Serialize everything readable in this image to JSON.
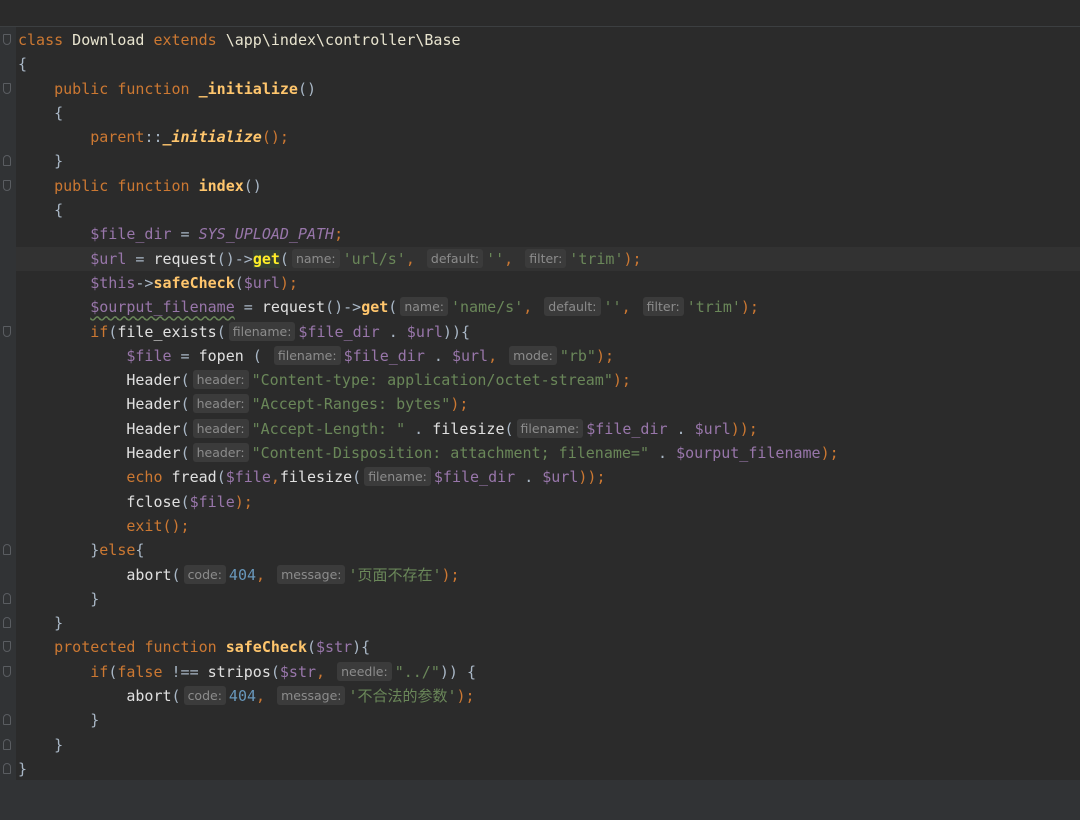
{
  "code": {
    "lines": [
      {
        "tokens": [
          {
            "t": "class",
            "c": "kw"
          },
          {
            "t": " Download ",
            "c": "cls"
          },
          {
            "t": "extends",
            "c": "kw"
          },
          {
            "t": " \\app\\index\\controller\\Base",
            "c": "cls"
          }
        ],
        "fold": "open"
      },
      {
        "tokens": [
          {
            "t": "{",
            "c": "plain"
          }
        ]
      },
      {
        "tokens": [
          {
            "t": "    "
          },
          {
            "t": "public",
            "c": "kw"
          },
          {
            "t": " "
          },
          {
            "t": "function",
            "c": "kw"
          },
          {
            "t": " "
          },
          {
            "t": "_initialize",
            "c": "fnb"
          },
          {
            "t": "()",
            "c": "plain"
          }
        ],
        "fold": "open"
      },
      {
        "tokens": [
          {
            "t": "    {",
            "c": "plain"
          }
        ]
      },
      {
        "tokens": [
          {
            "t": "        "
          },
          {
            "t": "parent",
            "c": "kw"
          },
          {
            "t": "::",
            "c": "plain"
          },
          {
            "t": "_initialize",
            "c": "fni"
          },
          {
            "t": "();",
            "c": "kw"
          }
        ]
      },
      {
        "tokens": [
          {
            "t": "    }",
            "c": "plain"
          }
        ],
        "fold": "close"
      },
      {
        "tokens": [
          {
            "t": "    "
          },
          {
            "t": "public",
            "c": "kw"
          },
          {
            "t": " "
          },
          {
            "t": "function",
            "c": "kw"
          },
          {
            "t": " "
          },
          {
            "t": "index",
            "c": "fnb"
          },
          {
            "t": "()",
            "c": "plain"
          }
        ],
        "fold": "open"
      },
      {
        "tokens": [
          {
            "t": "    {",
            "c": "plain"
          }
        ]
      },
      {
        "tokens": [
          {
            "t": "        "
          },
          {
            "t": "$file_dir",
            "c": "var"
          },
          {
            "t": " = ",
            "c": "plain"
          },
          {
            "t": "SYS_UPLOAD_PATH",
            "c": "const"
          },
          {
            "t": ";",
            "c": "kw"
          }
        ]
      },
      {
        "current": true,
        "tokens": [
          {
            "t": "        "
          },
          {
            "t": "$url",
            "c": "var"
          },
          {
            "t": " = ",
            "c": "plain"
          },
          {
            "t": "request",
            "c": "call"
          },
          {
            "t": "()->",
            "c": "plain"
          },
          {
            "t": "get",
            "c": "hl-get"
          },
          {
            "t": "(",
            "c": "plain"
          },
          {
            "h": "name:"
          },
          {
            "t": "'url/s'",
            "c": "str"
          },
          {
            "t": ", ",
            "c": "kw"
          },
          {
            "h": "default:"
          },
          {
            "t": "''",
            "c": "str"
          },
          {
            "t": ", ",
            "c": "kw"
          },
          {
            "h": "filter:"
          },
          {
            "t": "'trim'",
            "c": "str"
          },
          {
            "t": ");",
            "c": "kw"
          }
        ]
      },
      {
        "tokens": [
          {
            "t": "        "
          },
          {
            "t": "$this",
            "c": "var"
          },
          {
            "t": "->",
            "c": "plain"
          },
          {
            "t": "safeCheck",
            "c": "fnb"
          },
          {
            "t": "(",
            "c": "plain"
          },
          {
            "t": "$url",
            "c": "var"
          },
          {
            "t": ");",
            "c": "kw"
          }
        ]
      },
      {
        "tokens": [
          {
            "t": "        "
          },
          {
            "t": "$ourput_filename",
            "c": "var squiggle"
          },
          {
            "t": " = ",
            "c": "plain"
          },
          {
            "t": "request",
            "c": "call"
          },
          {
            "t": "()->",
            "c": "plain"
          },
          {
            "t": "get",
            "c": "fnb"
          },
          {
            "t": "(",
            "c": "plain"
          },
          {
            "h": "name:"
          },
          {
            "t": "'name/s'",
            "c": "str"
          },
          {
            "t": ", ",
            "c": "kw"
          },
          {
            "h": "default:"
          },
          {
            "t": "''",
            "c": "str"
          },
          {
            "t": ", ",
            "c": "kw"
          },
          {
            "h": "filter:"
          },
          {
            "t": "'trim'",
            "c": "str"
          },
          {
            "t": ");",
            "c": "kw"
          }
        ]
      },
      {
        "tokens": [
          {
            "t": "        "
          },
          {
            "t": "if",
            "c": "kw"
          },
          {
            "t": "(",
            "c": "plain"
          },
          {
            "t": "file_exists",
            "c": "call"
          },
          {
            "t": "(",
            "c": "plain"
          },
          {
            "h": "filename:"
          },
          {
            "t": "$file_dir",
            "c": "var"
          },
          {
            "t": " . ",
            "c": "plain"
          },
          {
            "t": "$url",
            "c": "var"
          },
          {
            "t": ")){",
            "c": "plain"
          }
        ],
        "fold": "open"
      },
      {
        "tokens": [
          {
            "t": "            "
          },
          {
            "t": "$file",
            "c": "var"
          },
          {
            "t": " = ",
            "c": "plain"
          },
          {
            "t": "fopen",
            "c": "call"
          },
          {
            "t": " ( ",
            "c": "plain"
          },
          {
            "h": "filename:"
          },
          {
            "t": "$file_dir",
            "c": "var"
          },
          {
            "t": " . ",
            "c": "plain"
          },
          {
            "t": "$url",
            "c": "var"
          },
          {
            "t": ", ",
            "c": "kw"
          },
          {
            "h": "mode:"
          },
          {
            "t": "\"rb\"",
            "c": "str"
          },
          {
            "t": ");",
            "c": "kw"
          }
        ]
      },
      {
        "tokens": [
          {
            "t": "            "
          },
          {
            "t": "Header",
            "c": "call"
          },
          {
            "t": "(",
            "c": "plain"
          },
          {
            "h": "header:"
          },
          {
            "t": "\"Content-type: application/octet-stream\"",
            "c": "str"
          },
          {
            "t": ");",
            "c": "kw"
          }
        ]
      },
      {
        "tokens": [
          {
            "t": "            "
          },
          {
            "t": "Header",
            "c": "call"
          },
          {
            "t": "(",
            "c": "plain"
          },
          {
            "h": "header:"
          },
          {
            "t": "\"Accept-Ranges: bytes\"",
            "c": "str"
          },
          {
            "t": ");",
            "c": "kw"
          }
        ]
      },
      {
        "tokens": [
          {
            "t": "            "
          },
          {
            "t": "Header",
            "c": "call"
          },
          {
            "t": "(",
            "c": "plain"
          },
          {
            "h": "header:"
          },
          {
            "t": "\"Accept-Length: \"",
            "c": "str"
          },
          {
            "t": " . ",
            "c": "plain"
          },
          {
            "t": "filesize",
            "c": "call"
          },
          {
            "t": "(",
            "c": "plain"
          },
          {
            "h": "filename:"
          },
          {
            "t": "$file_dir",
            "c": "var"
          },
          {
            "t": " . ",
            "c": "plain"
          },
          {
            "t": "$url",
            "c": "var"
          },
          {
            "t": "));",
            "c": "kw"
          }
        ]
      },
      {
        "tokens": [
          {
            "t": "            "
          },
          {
            "t": "Header",
            "c": "call"
          },
          {
            "t": "(",
            "c": "plain"
          },
          {
            "h": "header:"
          },
          {
            "t": "\"Content-Disposition: attachment; filename=\"",
            "c": "str"
          },
          {
            "t": " . ",
            "c": "plain"
          },
          {
            "t": "$ourput_filename",
            "c": "var"
          },
          {
            "t": ");",
            "c": "kw"
          }
        ]
      },
      {
        "tokens": [
          {
            "t": "            "
          },
          {
            "t": "echo",
            "c": "kw"
          },
          {
            "t": " "
          },
          {
            "t": "fread",
            "c": "call"
          },
          {
            "t": "(",
            "c": "plain"
          },
          {
            "t": "$file",
            "c": "var"
          },
          {
            "t": ",",
            "c": "kw"
          },
          {
            "t": "filesize",
            "c": "call"
          },
          {
            "t": "(",
            "c": "plain"
          },
          {
            "h": "filename:"
          },
          {
            "t": "$file_dir",
            "c": "var"
          },
          {
            "t": " . ",
            "c": "plain"
          },
          {
            "t": "$url",
            "c": "var"
          },
          {
            "t": "));",
            "c": "kw"
          }
        ]
      },
      {
        "tokens": [
          {
            "t": "            "
          },
          {
            "t": "fclose",
            "c": "call"
          },
          {
            "t": "(",
            "c": "plain"
          },
          {
            "t": "$file",
            "c": "var"
          },
          {
            "t": ");",
            "c": "kw"
          }
        ]
      },
      {
        "tokens": [
          {
            "t": "            "
          },
          {
            "t": "exit",
            "c": "kw"
          },
          {
            "t": "();",
            "c": "kw"
          }
        ]
      },
      {
        "tokens": [
          {
            "t": "        }",
            "c": "plain"
          },
          {
            "t": "else",
            "c": "kw"
          },
          {
            "t": "{",
            "c": "plain"
          }
        ],
        "fold": "close"
      },
      {
        "tokens": [
          {
            "t": "            "
          },
          {
            "t": "abort",
            "c": "call"
          },
          {
            "t": "(",
            "c": "plain"
          },
          {
            "h": "code:"
          },
          {
            "t": "404",
            "c": "num"
          },
          {
            "t": ", ",
            "c": "kw"
          },
          {
            "h": "message:"
          },
          {
            "t": "'页面不存在'",
            "c": "str"
          },
          {
            "t": ");",
            "c": "kw"
          }
        ]
      },
      {
        "tokens": [
          {
            "t": "        }",
            "c": "plain"
          }
        ],
        "fold": "close"
      },
      {
        "tokens": [
          {
            "t": "    }",
            "c": "plain"
          }
        ],
        "fold": "close"
      },
      {
        "tokens": [
          {
            "t": "    "
          },
          {
            "t": "protected",
            "c": "kw"
          },
          {
            "t": " "
          },
          {
            "t": "function",
            "c": "kw"
          },
          {
            "t": " "
          },
          {
            "t": "safeCheck",
            "c": "fnb"
          },
          {
            "t": "(",
            "c": "plain"
          },
          {
            "t": "$str",
            "c": "var"
          },
          {
            "t": "){",
            "c": "plain"
          }
        ],
        "fold": "open"
      },
      {
        "tokens": [
          {
            "t": "        "
          },
          {
            "t": "if",
            "c": "kw"
          },
          {
            "t": "(",
            "c": "plain"
          },
          {
            "t": "false",
            "c": "kw"
          },
          {
            "t": " !== ",
            "c": "plain"
          },
          {
            "t": "stripos",
            "c": "call"
          },
          {
            "t": "(",
            "c": "plain"
          },
          {
            "t": "$str",
            "c": "var"
          },
          {
            "t": ", ",
            "c": "kw"
          },
          {
            "h": "needle:"
          },
          {
            "t": "\"../\"",
            "c": "str"
          },
          {
            "t": ")) {",
            "c": "plain"
          }
        ],
        "fold": "open"
      },
      {
        "tokens": [
          {
            "t": "            "
          },
          {
            "t": "abort",
            "c": "call"
          },
          {
            "t": "(",
            "c": "plain"
          },
          {
            "h": "code:"
          },
          {
            "t": "404",
            "c": "num"
          },
          {
            "t": ", ",
            "c": "kw"
          },
          {
            "h": "message:"
          },
          {
            "t": "'不合法的参数'",
            "c": "str"
          },
          {
            "t": ");",
            "c": "kw"
          }
        ]
      },
      {
        "tokens": [
          {
            "t": "        }",
            "c": "plain"
          }
        ],
        "fold": "close"
      },
      {
        "tokens": [
          {
            "t": "    }",
            "c": "plain"
          }
        ],
        "fold": "close"
      },
      {
        "tokens": [
          {
            "t": "}",
            "c": "plain"
          }
        ],
        "fold": "close"
      }
    ]
  }
}
